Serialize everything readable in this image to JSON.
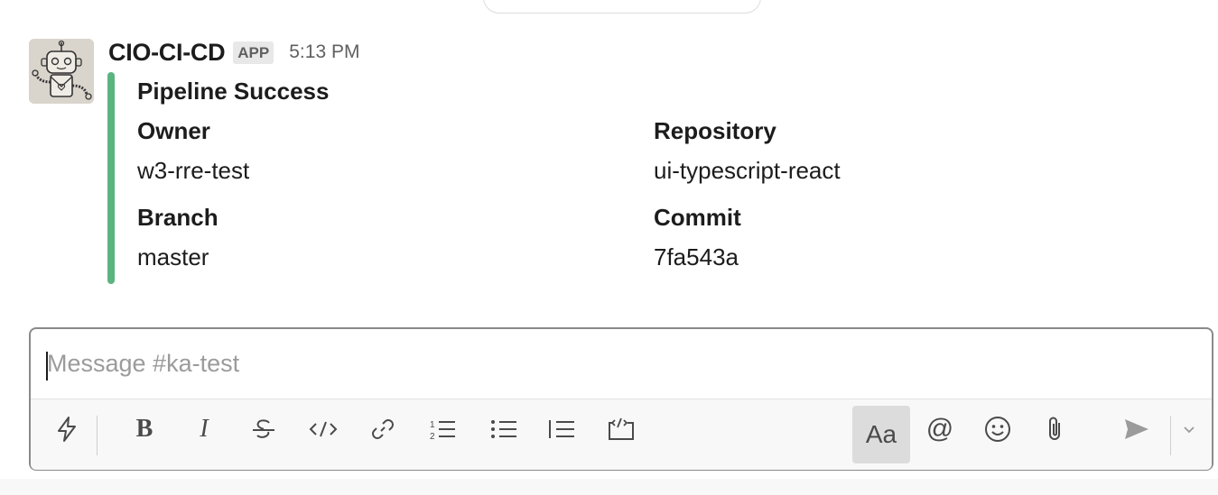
{
  "message": {
    "sender": "CIO-CI-CD",
    "badge": "APP",
    "time": "5:13 PM"
  },
  "attachment": {
    "title": "Pipeline Success",
    "accent_color": "#5bb47f",
    "fields": [
      {
        "title": "Owner",
        "value": "w3-rre-test"
      },
      {
        "title": "Repository",
        "value": "ui-typescript-react"
      },
      {
        "title": "Branch",
        "value": "master"
      },
      {
        "title": "Commit",
        "value": "7fa543a"
      }
    ]
  },
  "composer": {
    "placeholder": "Message #ka-test",
    "value": "",
    "toolbar": {
      "shortcuts_icon": "lightning-icon",
      "bold_label": "B",
      "italic_label": "I",
      "strike_icon": "strikethrough-icon",
      "code_icon": "code-icon",
      "link_icon": "link-icon",
      "ordered_list_icon": "ordered-list-icon",
      "bulleted_list_icon": "bulleted-list-icon",
      "blockquote_icon": "blockquote-icon",
      "code_block_icon": "code-block-icon",
      "format_label": "Aa",
      "mention_label": "@",
      "emoji_icon": "emoji-icon",
      "attach_icon": "paperclip-icon",
      "send_icon": "send-icon",
      "send_options_icon": "chevron-down-icon"
    }
  }
}
